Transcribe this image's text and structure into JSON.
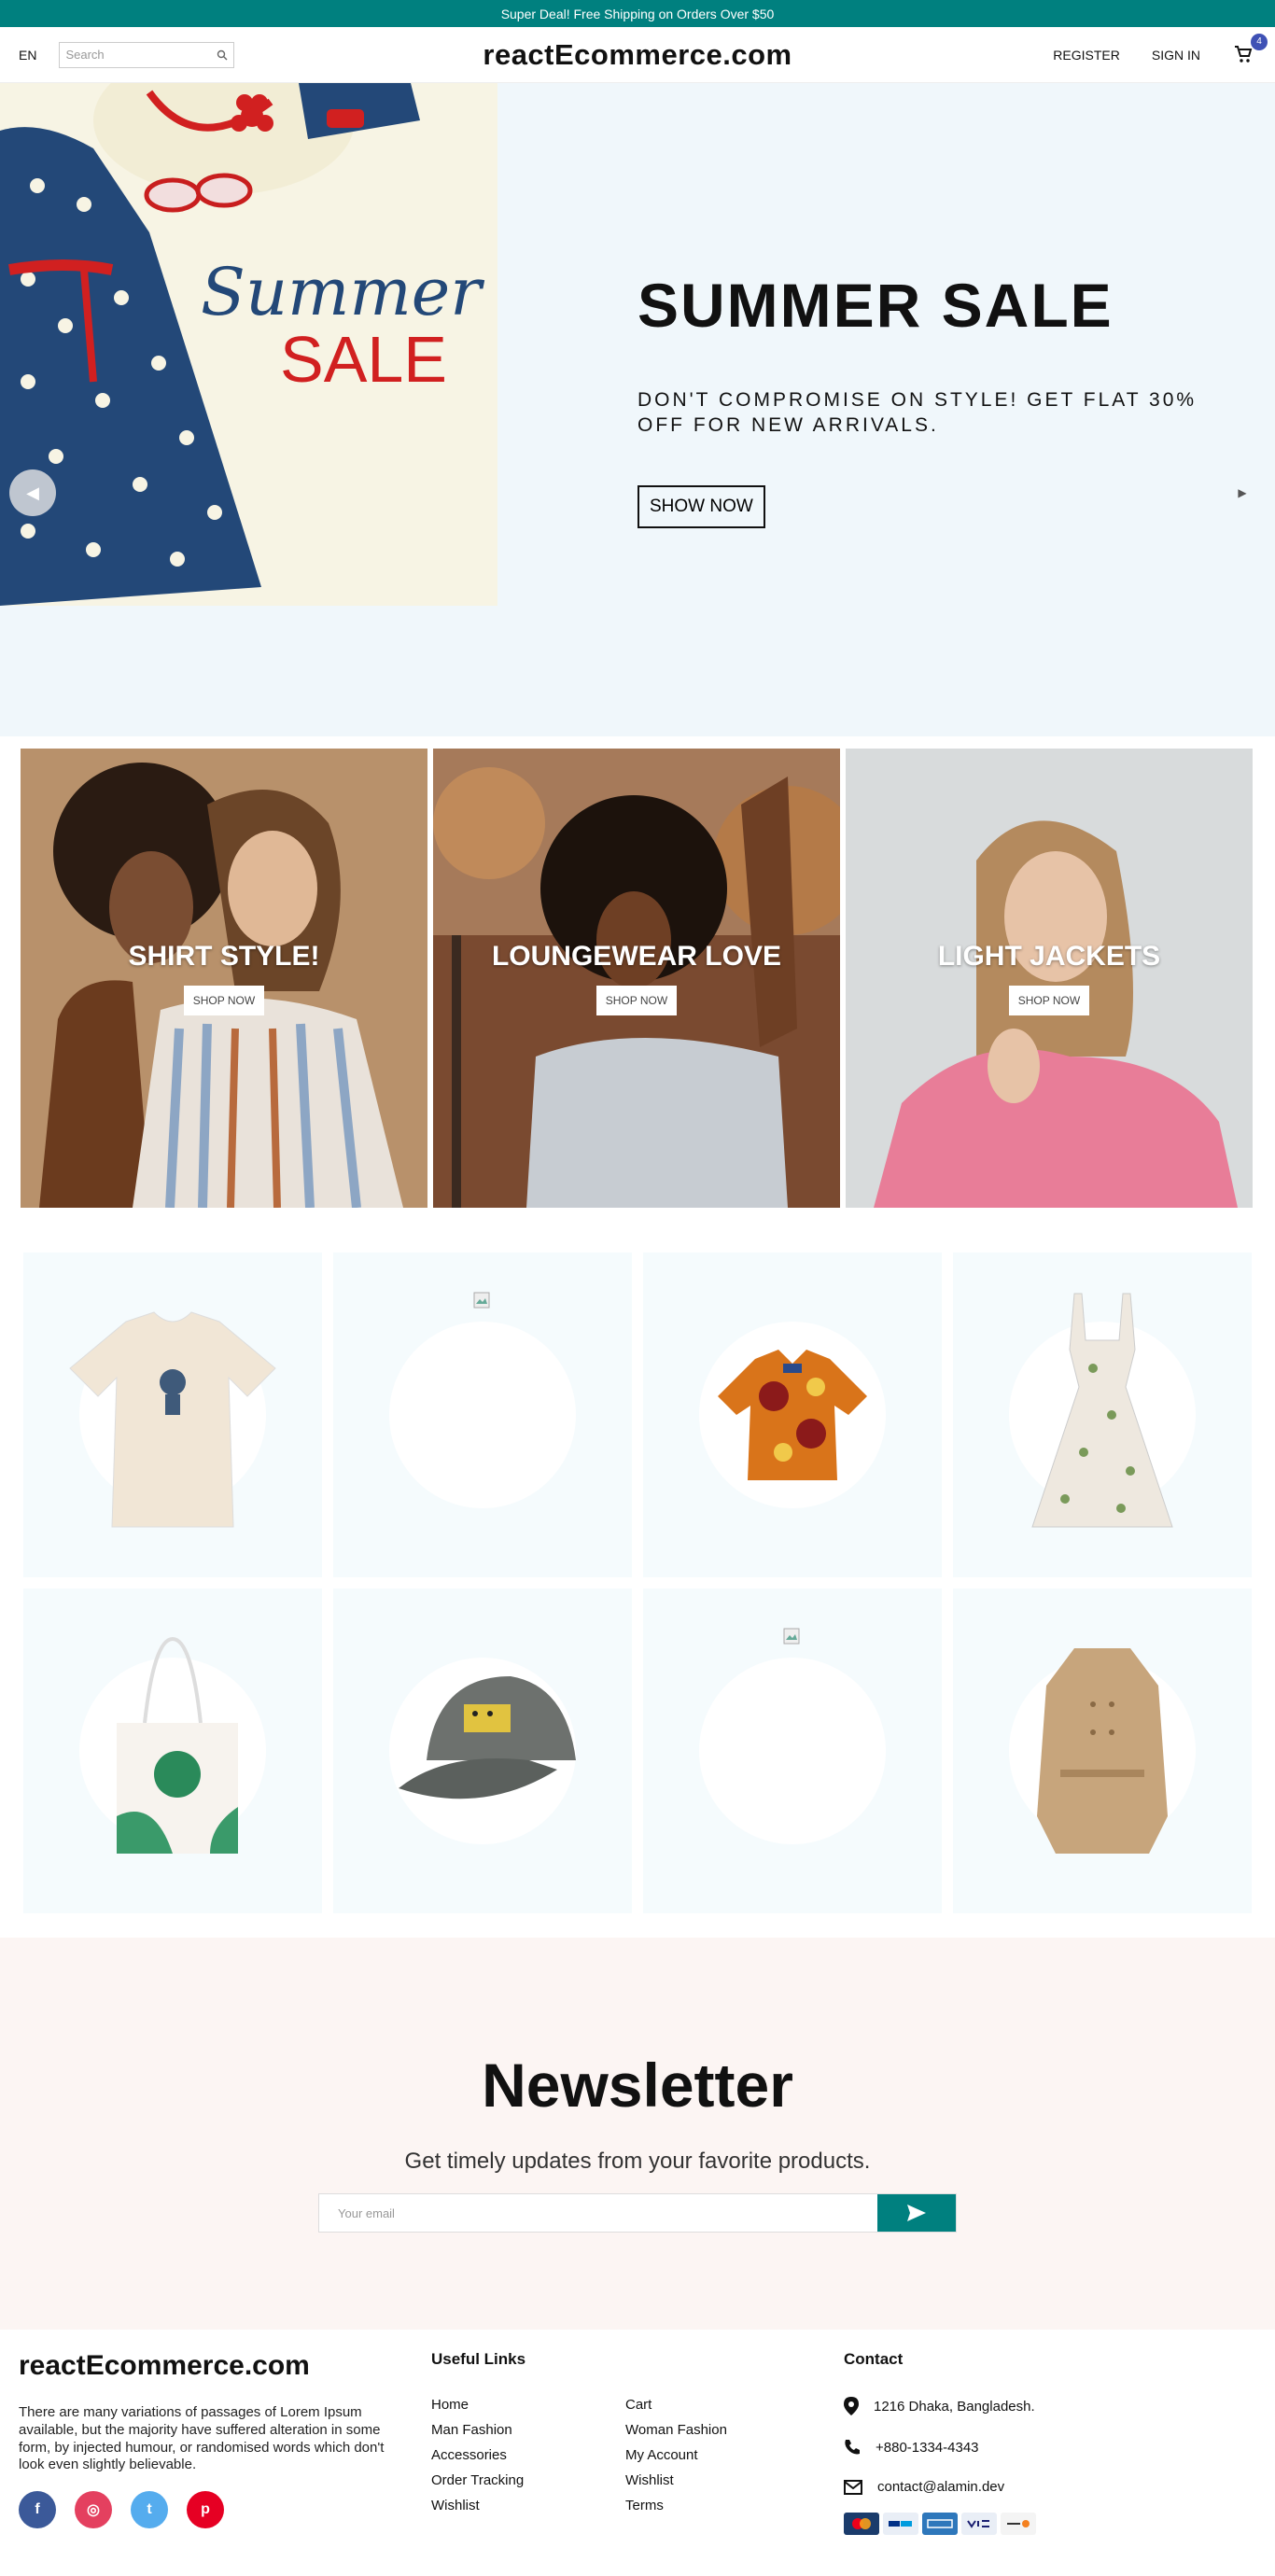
{
  "announcement": "Super Deal! Free Shipping on Orders Over $50",
  "navbar": {
    "language": "EN",
    "search_placeholder": "Search",
    "logo": "reactEcommerce.com",
    "register": "REGISTER",
    "sign_in": "SIGN IN",
    "cart_count": "4"
  },
  "hero": {
    "image_text_line1": "Summer",
    "image_text_line2": "SALE",
    "title": "SUMMER SALE",
    "description": "DON'T COMPROMISE ON STYLE! GET FLAT 30% OFF FOR NEW ARRIVALS.",
    "button": "SHOW NOW"
  },
  "categories": [
    {
      "title": "SHIRT STYLE!",
      "button": "SHOP NOW"
    },
    {
      "title": "LOUNGEWEAR LOVE",
      "button": "SHOP NOW"
    },
    {
      "title": "LIGHT JACKETS",
      "button": "SHOP NOW"
    }
  ],
  "products": [
    {
      "icon": "tshirt-icon"
    },
    {
      "icon": "broken-image-icon"
    },
    {
      "icon": "hawaiian-shirt-icon"
    },
    {
      "icon": "dress-icon"
    },
    {
      "icon": "tote-bag-icon"
    },
    {
      "icon": "cap-icon"
    },
    {
      "icon": "broken-image-icon"
    },
    {
      "icon": "trench-coat-icon"
    }
  ],
  "newsletter": {
    "title": "Newsletter",
    "description": "Get timely updates from your favorite products.",
    "placeholder": "Your email"
  },
  "footer": {
    "logo": "reactEcommerce.com",
    "description": "There are many variations of passages of Lorem Ipsum available, but the majority have suffered alteration in some form, by injected humour, or randomised words which don't look even slightly believable.",
    "useful_links_title": "Useful Links",
    "links": [
      "Home",
      "Cart",
      "Man Fashion",
      "Woman Fashion",
      "Accessories",
      "My Account",
      "Order Tracking",
      "Wishlist",
      "Wishlist",
      "Terms"
    ],
    "contact_title": "Contact",
    "address": "1216 Dhaka, Bangladesh.",
    "phone": "+880-1334-4343",
    "email": "contact@alamin.dev"
  },
  "colors": {
    "accent": "#00807f",
    "badge": "#3f51b5",
    "hero_bg": "#f0f7fb",
    "newsletter_bg": "#fcf5f3"
  }
}
